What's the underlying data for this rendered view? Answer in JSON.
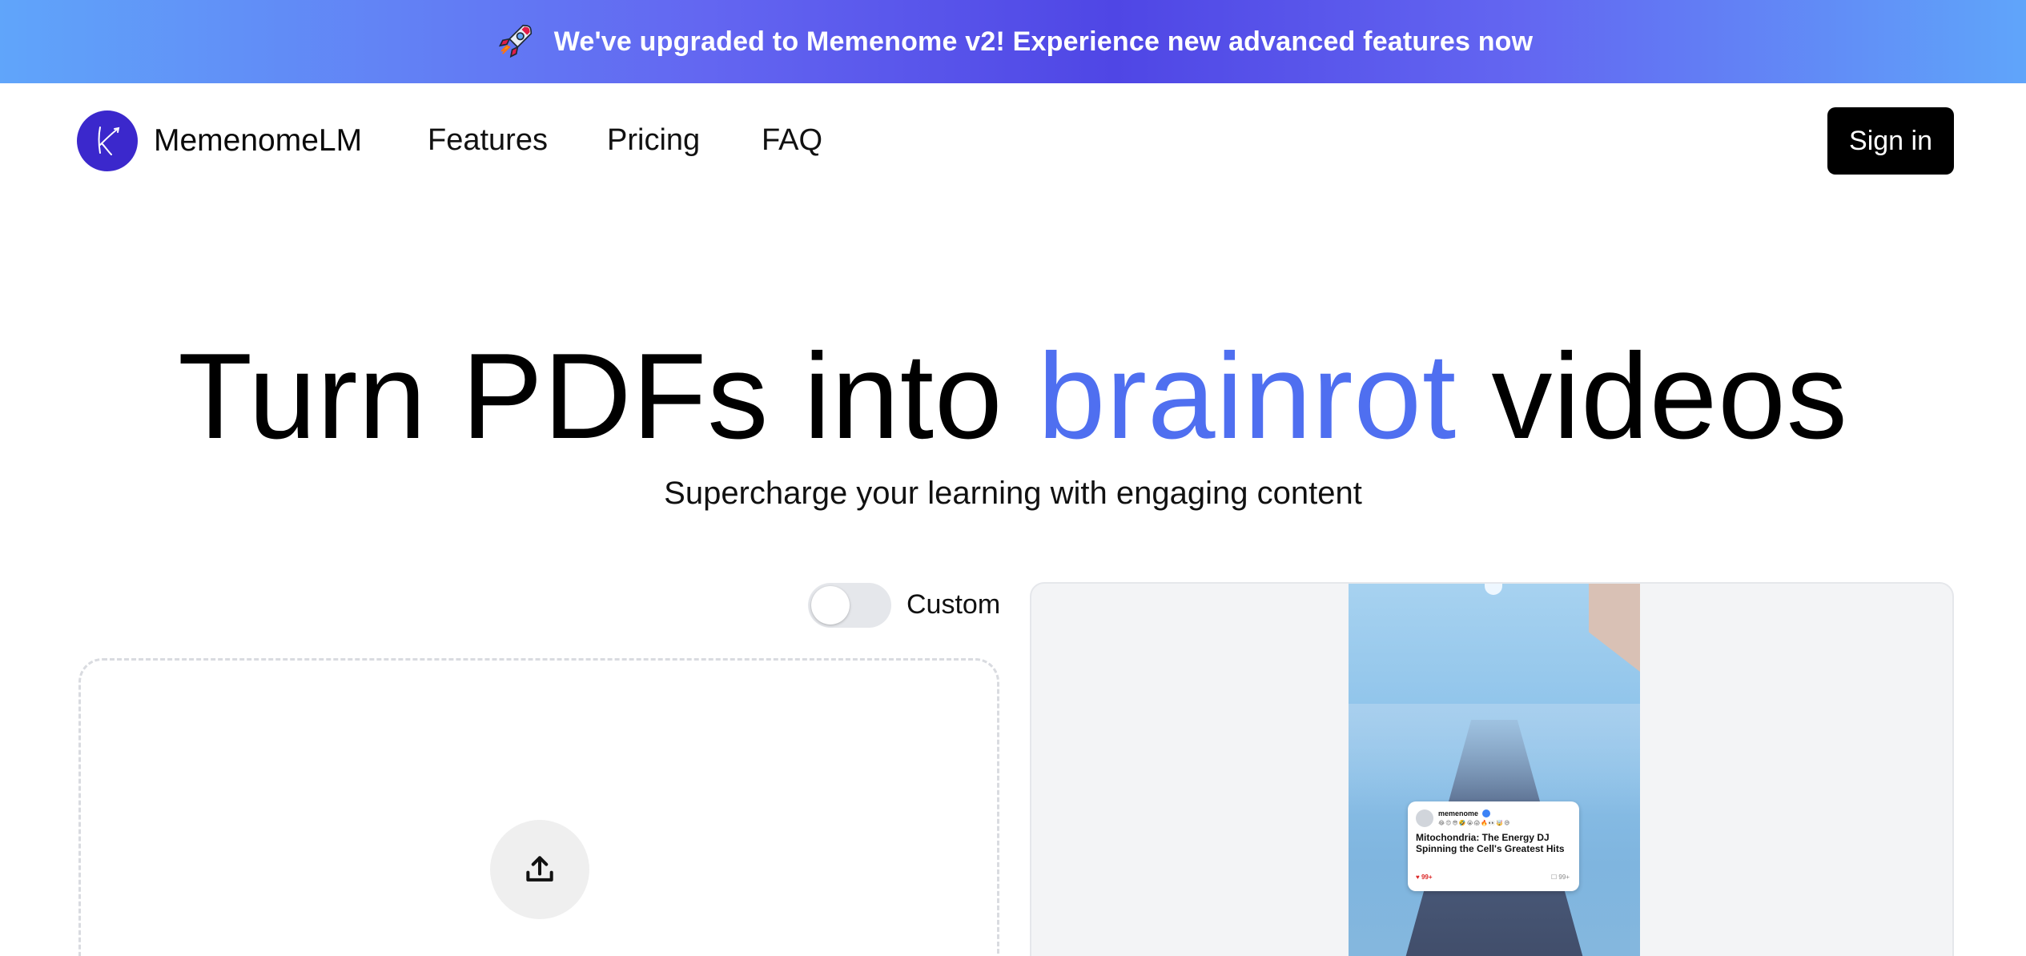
{
  "banner": {
    "text": "We've upgraded to Memenome v2! Experience new advanced features now",
    "icon": "rocket-icon"
  },
  "nav": {
    "brand": "MemenomeLM",
    "links": [
      "Features",
      "Pricing",
      "FAQ"
    ],
    "signin_label": "Sign in"
  },
  "hero": {
    "title_before": "Turn PDFs into ",
    "title_accent": "brainrot",
    "title_after": " videos",
    "subtitle": "Supercharge your learning with engaging content"
  },
  "toggle": {
    "label": "Custom",
    "checked": false
  },
  "upload": {
    "icon": "upload-icon"
  },
  "preview": {
    "card": {
      "username": "memenome",
      "emojis": "😂😍😎🤣😭😱🔥👀🤯😅",
      "title": "Mitochondria: The Energy DJ Spinning the Cell's Greatest Hits",
      "likes": "99+",
      "comments": "99+"
    }
  },
  "colors": {
    "accent": "#4f6ff0",
    "brand": "#3b28cc",
    "banner_gradient": [
      "#60a5fa",
      "#4f46e5"
    ]
  }
}
